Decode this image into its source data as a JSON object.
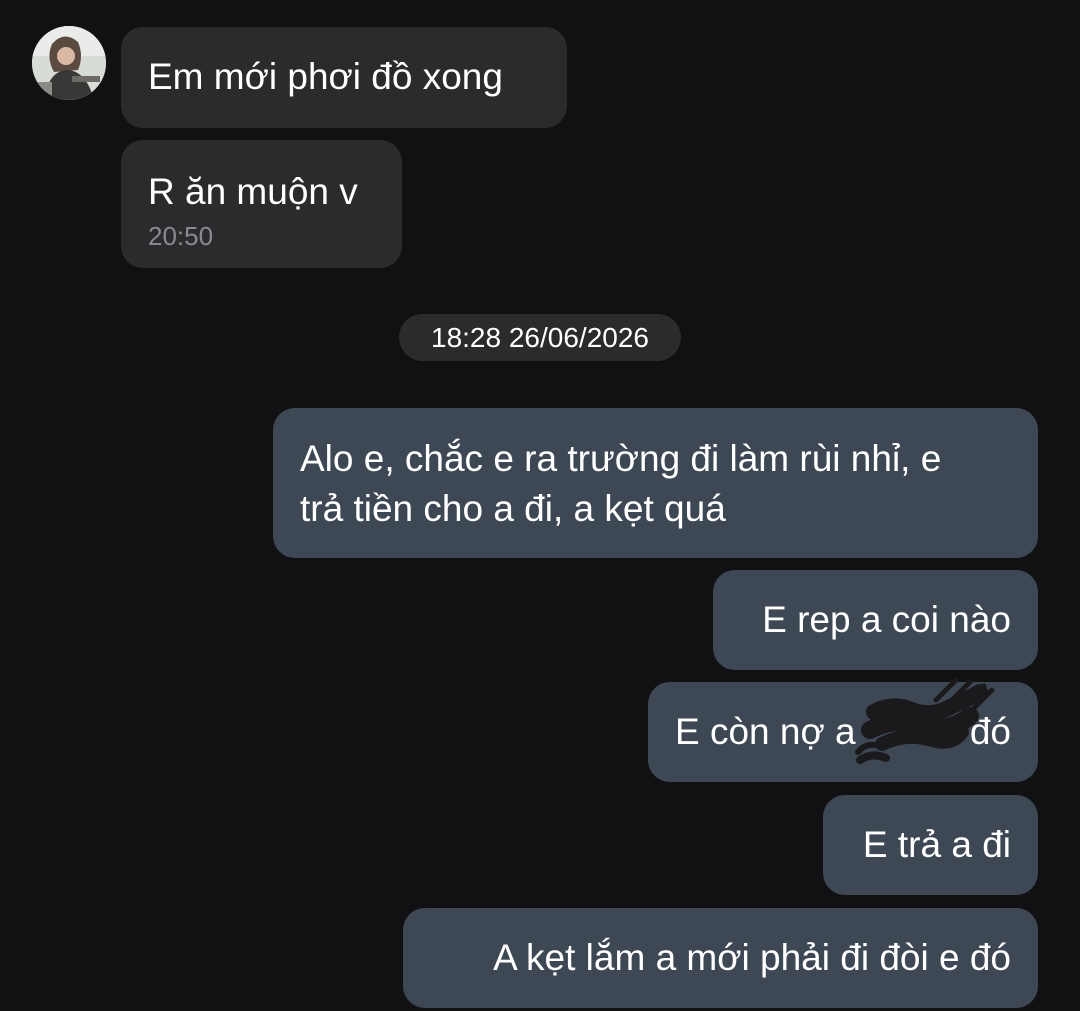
{
  "contact": {
    "avatar_icon": "contact-avatar"
  },
  "messages_incoming": [
    {
      "text": "Em mới phơi đồ xong"
    },
    {
      "text": "R ăn muộn v",
      "time": "20:50"
    }
  ],
  "date_separator": "18:28 26/06/2026",
  "messages_outgoing": [
    {
      "line1": "Alo e, chắc e ra trường đi làm rùi nhỉ, e",
      "line2": "trả tiền cho a đi, a kẹt quá"
    },
    {
      "text": "E rep a coi nào"
    },
    {
      "text_before": "E còn nợ a",
      "text_after": "đó",
      "redaction_icon": "scribble-redaction"
    },
    {
      "text": "E trả a đi"
    },
    {
      "text": "A kẹt lắm a mới phải đi đòi e đó"
    }
  ],
  "colors": {
    "background": "#111113",
    "incoming_bubble": "#2b2b2d",
    "outgoing_bubble": "#3e4855",
    "timestamp": "#8a8a8e"
  }
}
